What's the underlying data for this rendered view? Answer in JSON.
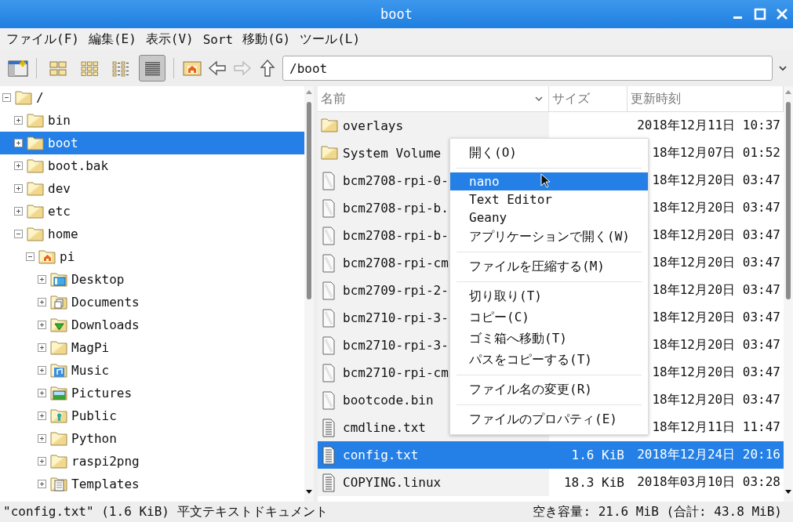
{
  "window": {
    "title": "boot"
  },
  "menubar": [
    "ファイル(F)",
    "編集(E)",
    "表示(V)",
    "Sort",
    "移動(G)",
    "ツール(L)"
  ],
  "toolbar": {
    "view_modes": [
      {
        "kind": "icons",
        "selected": false
      },
      {
        "kind": "thumbnails",
        "selected": false
      },
      {
        "kind": "compact",
        "selected": false
      },
      {
        "kind": "detailed",
        "selected": true
      }
    ],
    "navigation": [
      {
        "kind": "home",
        "disabled": false
      },
      {
        "kind": "back",
        "disabled": false
      },
      {
        "kind": "forward",
        "disabled": true
      },
      {
        "kind": "up",
        "disabled": false
      }
    ],
    "path": "/boot"
  },
  "tree": [
    {
      "label": "/",
      "kind": "folder",
      "expanded": true,
      "selected": false,
      "children": [
        {
          "label": "bin",
          "kind": "folder",
          "expanded": false,
          "selected": false
        },
        {
          "label": "boot",
          "kind": "folder",
          "expanded": false,
          "selected": true
        },
        {
          "label": "boot.bak",
          "kind": "folder",
          "expanded": false,
          "selected": false
        },
        {
          "label": "dev",
          "kind": "folder",
          "expanded": false,
          "selected": false
        },
        {
          "label": "etc",
          "kind": "folder",
          "expanded": false,
          "selected": false
        },
        {
          "label": "home",
          "kind": "folder",
          "expanded": true,
          "selected": false,
          "children": [
            {
              "label": "pi",
              "kind": "home",
              "expanded": true,
              "selected": false,
              "children": [
                {
                  "label": "Desktop",
                  "kind": "desktop",
                  "expanded": false,
                  "selected": false
                },
                {
                  "label": "Documents",
                  "kind": "documents",
                  "expanded": false,
                  "selected": false
                },
                {
                  "label": "Downloads",
                  "kind": "downloads",
                  "expanded": false,
                  "selected": false
                },
                {
                  "label": "MagPi",
                  "kind": "folder",
                  "expanded": false,
                  "selected": false
                },
                {
                  "label": "Music",
                  "kind": "music",
                  "expanded": false,
                  "selected": false
                },
                {
                  "label": "Pictures",
                  "kind": "pictures",
                  "expanded": false,
                  "selected": false
                },
                {
                  "label": "Public",
                  "kind": "public",
                  "expanded": false,
                  "selected": false
                },
                {
                  "label": "Python",
                  "kind": "folder",
                  "expanded": false,
                  "selected": false
                },
                {
                  "label": "raspi2png",
                  "kind": "folder",
                  "expanded": false,
                  "selected": false
                },
                {
                  "label": "Templates",
                  "kind": "templates",
                  "expanded": false,
                  "selected": false
                }
              ]
            }
          ]
        }
      ]
    }
  ],
  "file_list": {
    "columns": [
      "名前",
      "サイズ",
      "更新時刻"
    ],
    "rows": [
      {
        "kind": "folder",
        "name": "overlays",
        "date": "2018年12月11日 10:37",
        "selected": false
      },
      {
        "kind": "folder",
        "name": "System Volume",
        "date": "18年12月07日 01:52",
        "selected": false
      },
      {
        "kind": "file",
        "name": "bcm2708-rpi-0-",
        "date": "18年12月20日 03:47",
        "selected": false
      },
      {
        "kind": "file",
        "name": "bcm2708-rpi-b.",
        "date": "18年12月20日 03:47",
        "selected": false
      },
      {
        "kind": "file",
        "name": "bcm2708-rpi-b-",
        "date": "18年12月20日 03:47",
        "selected": false
      },
      {
        "kind": "file",
        "name": "bcm2708-rpi-cm",
        "date": "18年12月20日 03:47",
        "selected": false
      },
      {
        "kind": "file",
        "name": "bcm2709-rpi-2-",
        "date": "18年12月20日 03:47",
        "selected": false
      },
      {
        "kind": "file",
        "name": "bcm2710-rpi-3-",
        "date": "18年12月20日 03:47",
        "selected": false
      },
      {
        "kind": "file",
        "name": "bcm2710-rpi-3-",
        "date": "18年12月20日 03:47",
        "selected": false
      },
      {
        "kind": "file",
        "name": "bcm2710-rpi-cm",
        "date": "18年12月20日 03:47",
        "selected": false
      },
      {
        "kind": "file",
        "name": "bootcode.bin",
        "date": "18年12月20日 03:47",
        "selected": false
      },
      {
        "kind": "text",
        "name": "cmdline.txt",
        "date": "18年12月11日 11:47",
        "selected": false
      },
      {
        "kind": "text",
        "name": "config.txt",
        "size": "1.6 KiB",
        "date": "2018年12月24日 20:16",
        "selected": true
      },
      {
        "kind": "text",
        "name": "COPYING.linux",
        "size": "18.3 KiB",
        "date": "2018年03月10日 03:28",
        "selected": false
      }
    ]
  },
  "context_menu": [
    {
      "kind": "item",
      "label": "開く(O)",
      "selected": false
    },
    {
      "kind": "separator"
    },
    {
      "kind": "app",
      "label": "nano",
      "selected": true
    },
    {
      "kind": "app",
      "label": "Text Editor",
      "selected": false
    },
    {
      "kind": "app",
      "label": "Geany",
      "selected": false
    },
    {
      "kind": "item",
      "label": "アプリケーションで開く(W)",
      "selected": false
    },
    {
      "kind": "separator"
    },
    {
      "kind": "item",
      "label": "ファイルを圧縮する(M)",
      "selected": false
    },
    {
      "kind": "separator"
    },
    {
      "kind": "item",
      "label": "切り取り(T)",
      "selected": false
    },
    {
      "kind": "item",
      "label": "コピー(C)",
      "selected": false
    },
    {
      "kind": "item",
      "label": "ゴミ箱へ移動(T)",
      "selected": false
    },
    {
      "kind": "item",
      "label": "パスをコピーする(T)",
      "selected": false
    },
    {
      "kind": "separator"
    },
    {
      "kind": "item",
      "label": "ファイル名の変更(R)",
      "selected": false
    },
    {
      "kind": "separator"
    },
    {
      "kind": "item",
      "label": "ファイルのプロパティ(E)",
      "selected": false
    }
  ],
  "status_bar": {
    "selection": "\"config.txt\" (1.6 KiB) 平文テキストドキュメント",
    "free_space": "空き容量: 21.6 MiB (合計: 43.8 MiB)"
  }
}
